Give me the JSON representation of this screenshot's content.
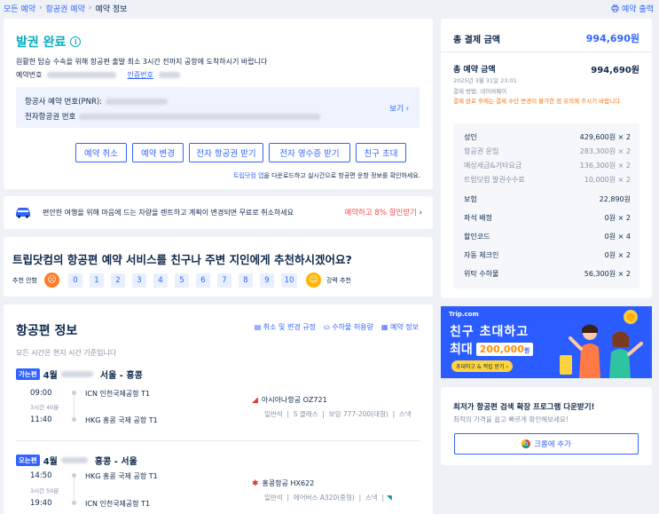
{
  "breadcrumb": {
    "items": [
      "모든 예약",
      "항공권 예약"
    ],
    "current": "예약 정보"
  },
  "print_label": "예약 출력",
  "status": {
    "title": "발권 완료",
    "notice": "원활한 탑승 수속을 위해 항공편 출발 최소 3시간 전까지 공항에 도착하시기 바랍니다",
    "booking_no_label": "예약번호",
    "auth_no_label": "인증번호",
    "pnr_label": "항공사 예약 번호(PNR):",
    "eticket_label": "전자항공권 번호",
    "view_more": "보기"
  },
  "actions": [
    "예약 취소",
    "예약 변경",
    "전자 항공권 받기",
    "전자 영수증 받기",
    "친구 초대"
  ],
  "app_notice": {
    "link": "트립닷컴 앱",
    "rest": "을 다운로드하고 실시간으로 항공편 운항 정보를 확인하세요."
  },
  "car_banner": {
    "text": "편안한 여행을 위해 마음에 드는 차량을 렌트하고 계획이 변경되면 무료로 취소하세요",
    "cta": "예약하고 8% 할인받기"
  },
  "recommend": {
    "question": "트립닷컴의 항공편 예약 서비스를 친구나 주변 지인에게 추천하시겠어요?",
    "low_label": "추천 안함",
    "high_label": "강력 추천",
    "scores": [
      "0",
      "1",
      "2",
      "3",
      "4",
      "5",
      "6",
      "7",
      "8",
      "9",
      "10"
    ]
  },
  "flight_info": {
    "title": "항공편 정보",
    "links": [
      "취소 및 변경 규정",
      "수하물 허용량",
      "예약 정보"
    ],
    "timezone_note": "모든 시간은 현지 시간 기준입니다",
    "legs": [
      {
        "tag": "가는편",
        "date_prefix": "4월",
        "route": "서울 - 홍콩",
        "dep_time": "09:00",
        "dep_airport": "ICN  인천국제공항 T1",
        "duration": "3시간 40분",
        "arr_time": "11:40",
        "arr_airport": "HKG  홍콩 국제 공항 T1",
        "airline": "아시아나항공 OZ721",
        "details": "일반석  |  S 클래스  |  보잉 777-200(대형)  |  스낵"
      },
      {
        "tag": "오는편",
        "date_prefix": "4월",
        "route": "홍콩 - 서울",
        "dep_time": "14:50",
        "dep_airport": "HKG  홍콩 국제 공항 T1",
        "duration": "3시간 50분",
        "arr_time": "19:40",
        "arr_airport": "ICN  인천국제공항 T1",
        "airline": "홍콩항공 HX622",
        "details": "일반석  |  에어버스 A320(중형)  |  스낵  |"
      }
    ]
  },
  "payment": {
    "total_label": "총 결제 금액",
    "total_value": "994,690원",
    "booking_total_label": "총 예약 금액",
    "booking_total_value": "994,690원",
    "date": "2025년 3월 31일 23:01",
    "method": "결제 방법: 네이버페이",
    "warning": "결제 완료 후에는 결제 수단 변경이 불가한 점 유의해 주시기 바랍니다.",
    "breakdown": [
      {
        "label": "성인",
        "value": "429,600원 × 2",
        "strong": true
      },
      {
        "label": "항공권 운임",
        "value": "283,300원 × 2",
        "strong": false
      },
      {
        "label": "예상세금&기타요금",
        "value": "136,300원 × 2",
        "strong": false
      },
      {
        "label": "트립닷컴 발권수수료",
        "value": "10,000원 × 2",
        "strong": false
      },
      {
        "label": "보험",
        "value": "22,890원",
        "strong": true
      },
      {
        "label": "좌석 배정",
        "value": "0원 × 2",
        "strong": true
      },
      {
        "label": "할인코드",
        "value": "0원 × 4",
        "strong": true
      },
      {
        "label": "자동 체크인",
        "value": "0원 × 2",
        "strong": true
      },
      {
        "label": "위탁 수하물",
        "value": "56,300원 × 2",
        "strong": true
      }
    ]
  },
  "ad": {
    "brand": "Trip.com",
    "line1": "친구 초대하고",
    "line2_prefix": "최대",
    "amount": "200,000",
    "unit": "원",
    "cta": "초대하고 & 적립 받기 ›"
  },
  "extension": {
    "title": "최저가 항공편 검색 확장 프로그램 다운받기!",
    "subtitle": "최적의 가격을 쉽고 빠르게 확인해보세요!",
    "button": "크롬에 추가"
  },
  "colors": {
    "accent": "#3264ff",
    "warning": "#ff6f00",
    "ad_bg": "#2b5cff"
  }
}
